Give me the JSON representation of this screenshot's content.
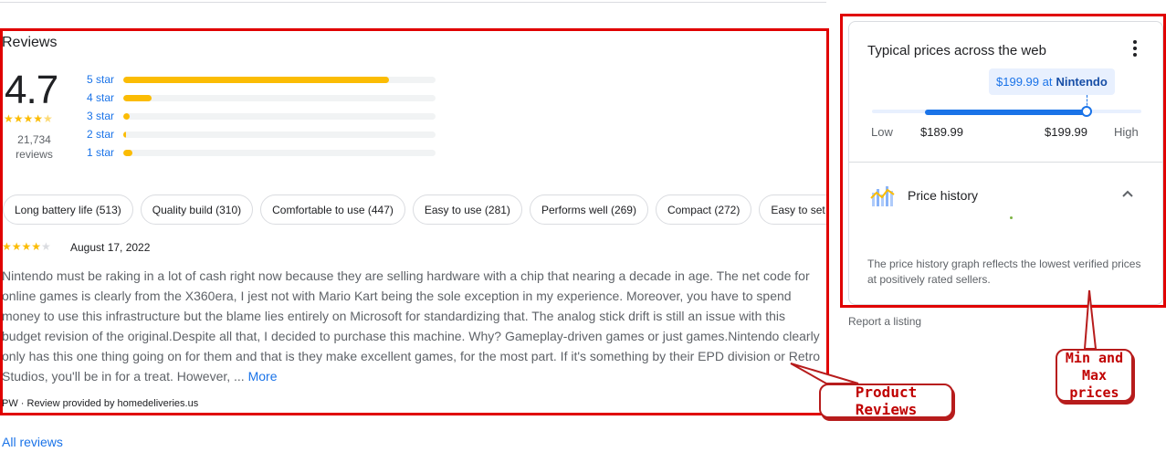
{
  "reviews": {
    "title": "Reviews",
    "score": "4.7",
    "score_stars": "★★★★",
    "score_half_star": "★",
    "count_number": "21,734",
    "count_label": "reviews",
    "distribution": [
      {
        "label": "5 star",
        "fraction": 0.85
      },
      {
        "label": "4 star",
        "fraction": 0.09
      },
      {
        "label": "3 star",
        "fraction": 0.02
      },
      {
        "label": "2 star",
        "fraction": 0.01
      },
      {
        "label": "1 star",
        "fraction": 0.03
      }
    ],
    "chips": [
      "Long battery life (513)",
      "Quality build (310)",
      "Comfortable to use (447)",
      "Easy to use (281)",
      "Performs well (269)",
      "Compact (272)",
      "Easy to set up"
    ],
    "review": {
      "stars_filled": "★★★★",
      "stars_empty": "★",
      "date": "August 17, 2022",
      "text": "Nintendo must be raking in a lot of cash right now because they are selling hardware with a chip that nearing a decade in age. The net code for online games is clearly from the X360era, I jest not with Mario Kart being the sole exception in my experience. Moreover, you have to spend money to use this infrastructure but the blame lies entirely on Microsoft for standardizing that. The analog stick drift is still an issue with this budget revision of the original.Despite all that, I decided to purchase this machine. Why? Gameplay-driven games or just games.Nintendo clearly only has this one thing going on for them and that is they make excellent games, for the most part. If it's something by their EPD division or Retro Studios, you'll be in for a treat. However, ...",
      "more_label": "More",
      "source": "PW · Review provided by homedeliveries.us"
    },
    "all_reviews_label": "All reviews"
  },
  "prices": {
    "title": "Typical prices across the web",
    "menu_icon": "more-vert-icon",
    "tooltip_price": "$199.99 at",
    "tooltip_store": "Nintendo",
    "low_label": "Low",
    "low_value": "$189.99",
    "high_value": "$199.99",
    "high_label": "High",
    "history_label": "Price history",
    "history_icon": "price-history-chart-icon",
    "note": "The price history graph reflects the lowest verified prices at positively rated sellers.",
    "report_label": "Report a listing"
  },
  "annotations": {
    "reviews_callout": "Product Reviews",
    "prices_callout_line1": "Min and",
    "prices_callout_line2": "Max",
    "prices_callout_line3": "prices",
    "color": "#e00000"
  }
}
